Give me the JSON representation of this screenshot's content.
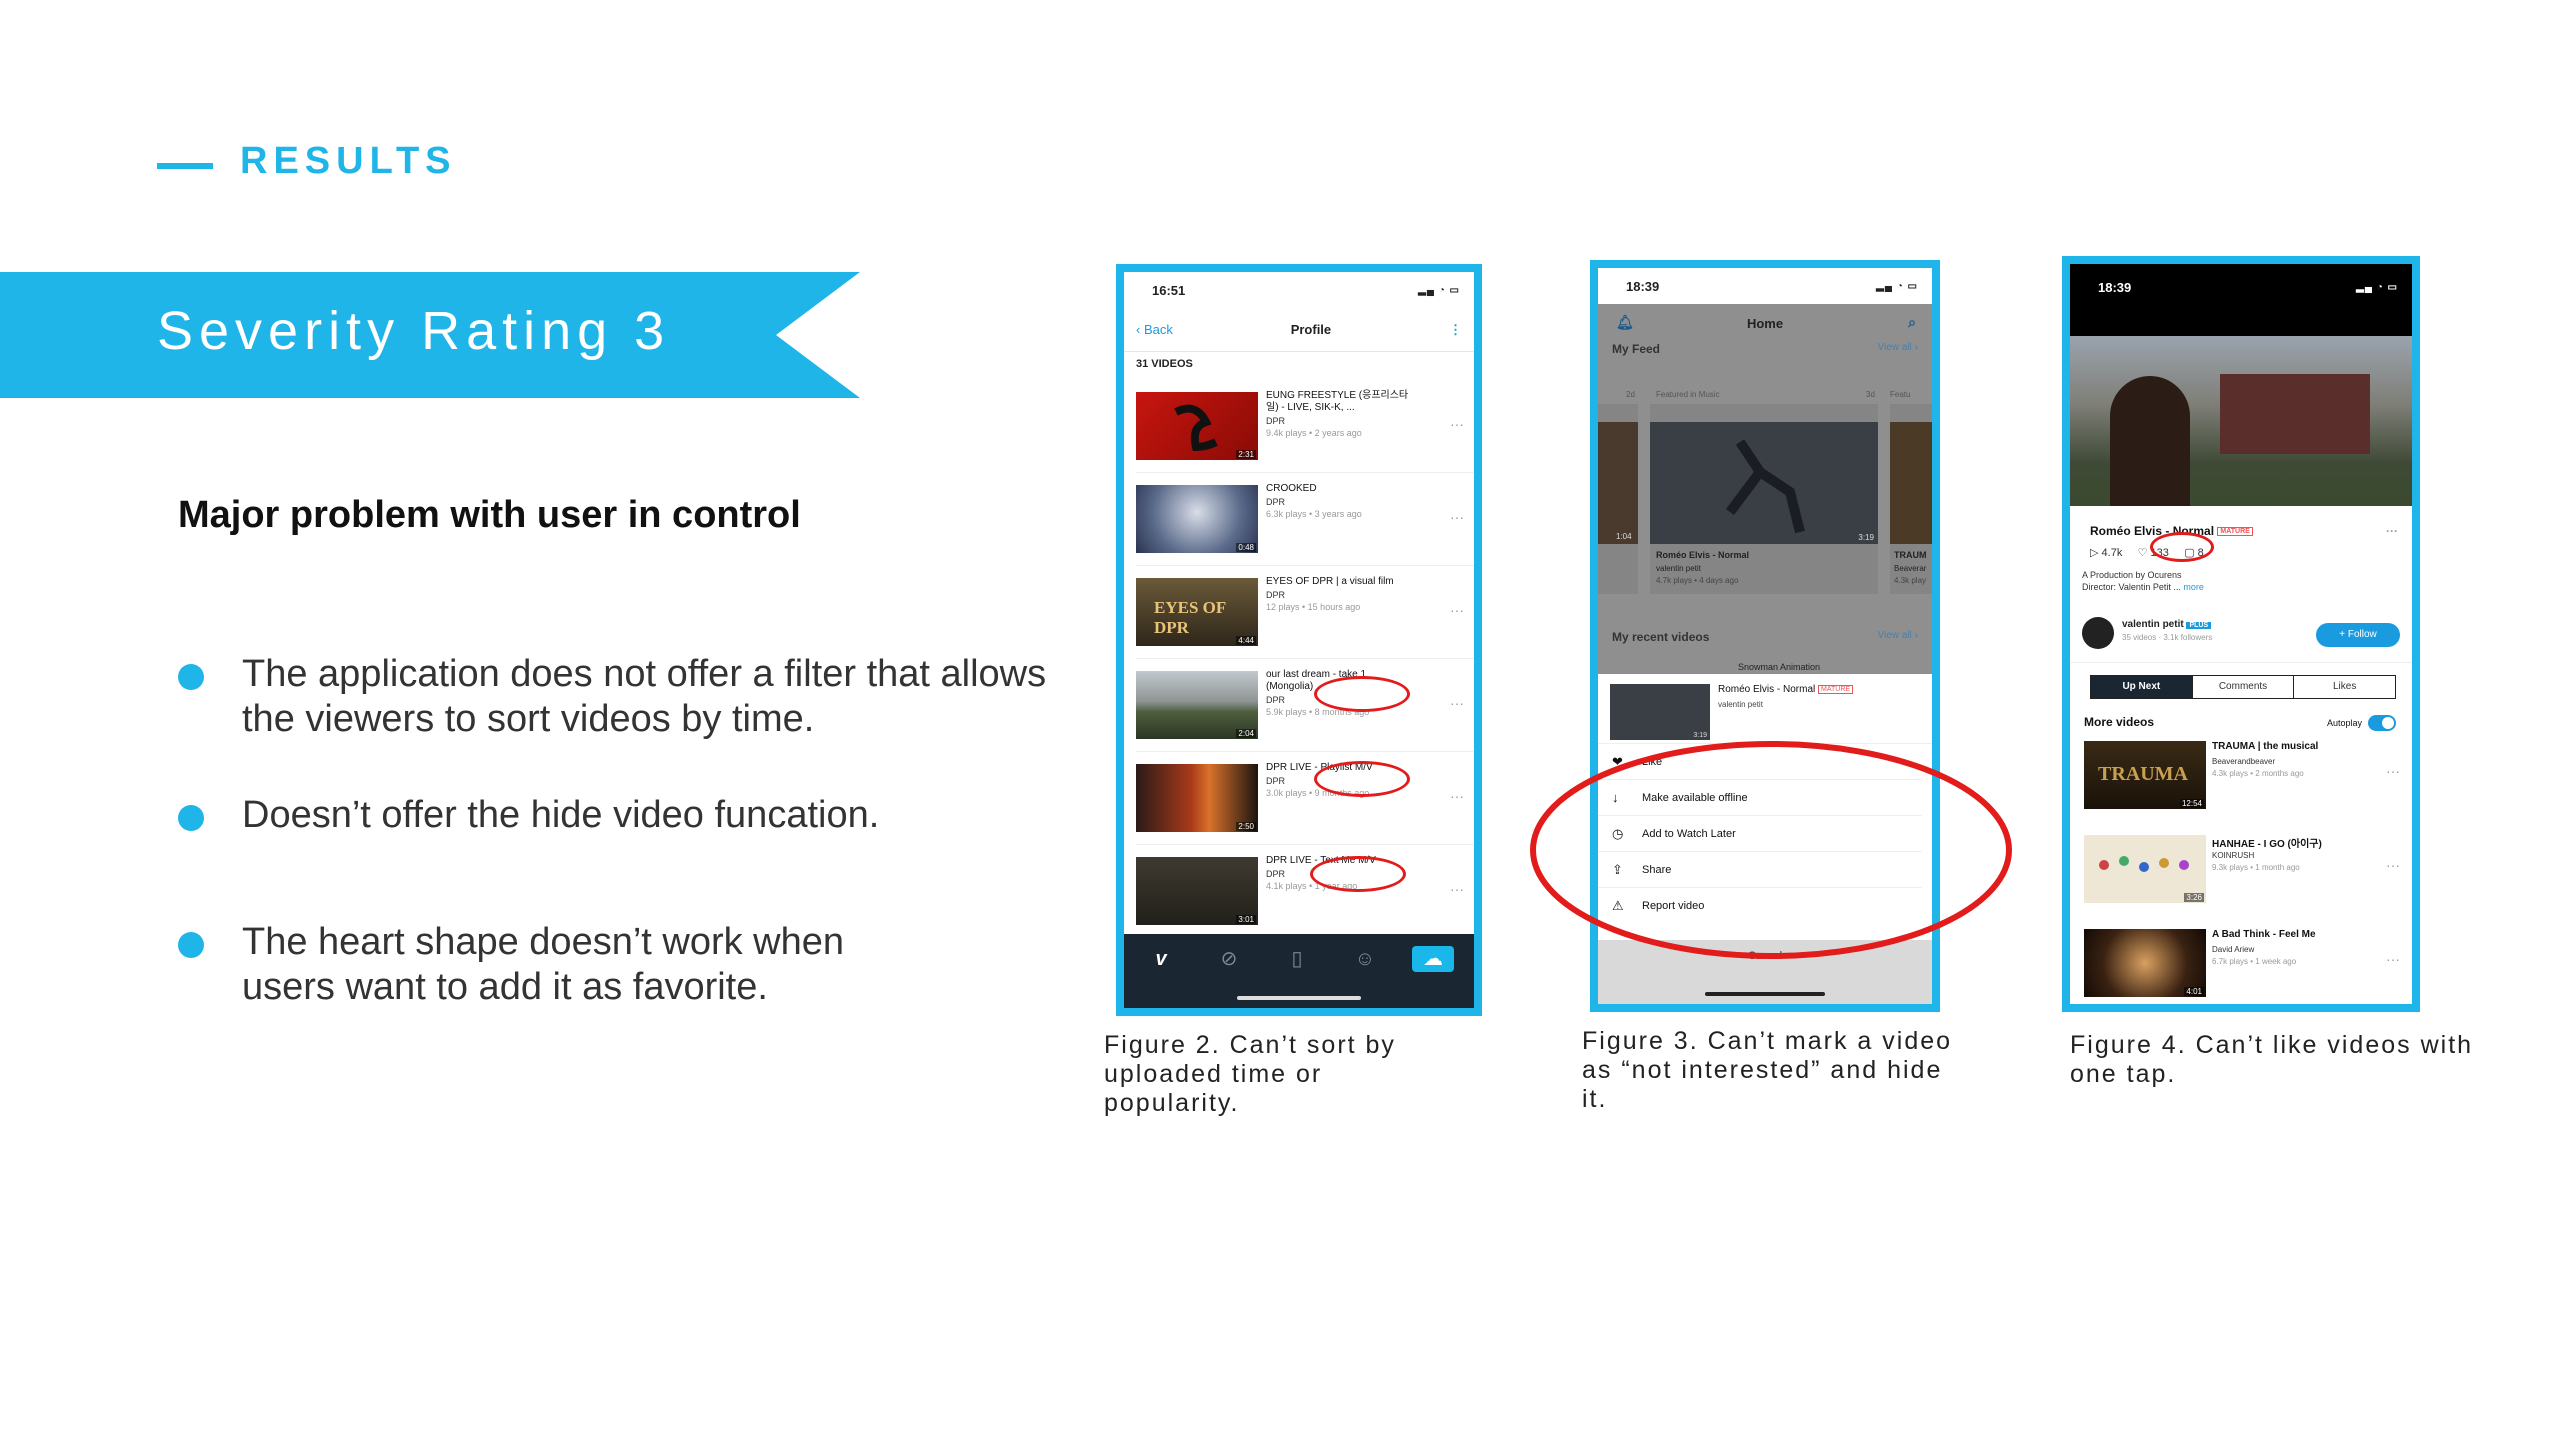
{
  "header": {
    "section": "RESULTS"
  },
  "banner": {
    "title": "Severity Rating 3"
  },
  "subtitle": "Major problem with user in control",
  "bullets": [
    "The application does not offer a filter that allows the viewers to sort videos by time.",
    "Doesn’t offer the hide video funcation.",
    "The heart shape doesn’t work when users want to add it as favorite."
  ],
  "captions": {
    "fig2": "Figure 2. Can’t sort by uploaded time or popularity.",
    "fig3": "Figure 3. Can’t mark a video as “not interested” and hide it.",
    "fig4": "Figure 4. Can’t like videos with one tap."
  },
  "colors": {
    "accent": "#1fb5e8",
    "highlight_ring": "#e21b1b"
  },
  "phone1": {
    "time": "16:51",
    "back": "Back",
    "title": "Profile",
    "count": "31 VIDEOS",
    "videos": [
      {
        "title": "EUNG FREESTYLE (응프리스타일) - LIVE, SIK-K, ...",
        "channel": "DPR",
        "meta": "9.4k plays • 2 years ago",
        "dur": "2:31"
      },
      {
        "title": "CROOKED",
        "channel": "DPR",
        "meta": "6.3k plays • 3 years ago",
        "dur": "0:48"
      },
      {
        "title": "EYES OF DPR | a visual film",
        "channel": "DPR",
        "meta": "12 plays • 15 hours ago",
        "dur": "4:44"
      },
      {
        "title": "our last dream - take 1 (Mongolia)",
        "channel": "DPR",
        "meta": "5.9k plays • 8 months ago",
        "dur": "2:04"
      },
      {
        "title": "DPR LIVE - Playlist M/V",
        "channel": "DPR",
        "meta": "3.0k plays • 9 months ago",
        "dur": "2:50"
      },
      {
        "title": "DPR LIVE - Text Me M/V",
        "channel": "DPR",
        "meta": "4.1k plays • 1 year ago",
        "dur": "3:01"
      }
    ],
    "tabs": [
      "vimeo-icon",
      "compass-icon",
      "bookmark-icon",
      "smiley-icon",
      "upload-icon"
    ]
  },
  "phone2": {
    "time": "18:39",
    "title": "Home",
    "feed_label": "My Feed",
    "view_all": "View all ›",
    "feed_tag_left": "2d",
    "feed_tag": "Featured in Music",
    "feed_tag_right": "3d",
    "feed_tag2": "Featu",
    "card_title": "Roméo Elvis - Normal",
    "card_user": "valentin petit",
    "card_meta": "4.7k plays • 4 days ago",
    "card_dur": "3:19",
    "left_dur": "1:04",
    "card2_title": "TRAUM",
    "card2_user": "Beaverar",
    "card2_meta": "4.3k play",
    "recent_label": "My recent videos",
    "recent_peek": "Snowman Animation",
    "sheet_title": "Roméo Elvis - Normal",
    "sheet_badge": "MATURE",
    "sheet_user": "valentin petit",
    "sheet_dur": "3:19",
    "actions": [
      {
        "icon": "heart-icon",
        "glyph": "❤",
        "label": "Like"
      },
      {
        "icon": "download-icon",
        "glyph": "↓",
        "label": "Make available offline"
      },
      {
        "icon": "clock-icon",
        "glyph": "◷",
        "label": "Add to Watch Later"
      },
      {
        "icon": "share-icon",
        "glyph": "⇪",
        "label": "Share"
      },
      {
        "icon": "warning-icon",
        "glyph": "⚠",
        "label": "Report video"
      }
    ],
    "cancel": "Cancel"
  },
  "phone3": {
    "time": "18:39",
    "title": "Roméo Elvis - Normal",
    "badge": "MATURE",
    "plays": "4.7k",
    "likes": "133",
    "comments": "8",
    "desc1": "A Production by Ocurens",
    "desc2": "Director: Valentin Petit ...",
    "more": "more",
    "user": "valentin petit",
    "plus": "PLUS",
    "user_meta": "35 videos · 3.1k followers",
    "follow": "+ Follow",
    "tabs": [
      "Up Next",
      "Comments",
      "Likes"
    ],
    "more_videos": "More videos",
    "autoplay": "Autoplay",
    "videos": [
      {
        "title": "TRAUMA | the musical",
        "channel": "Beaverandbeaver",
        "meta": "4.3k plays • 2 months ago",
        "dur": "12:54",
        "thumb_text": "TRAUMA"
      },
      {
        "title": "HANHAE - I GO (아이구)",
        "channel": "KOINRUSH",
        "meta": "9.3k plays • 1 month ago",
        "dur": "3:26",
        "thumb_text": ""
      },
      {
        "title": "A Bad Think - Feel Me",
        "channel": "David Ariew",
        "meta": "6.7k plays • 1 week ago",
        "dur": "4:01",
        "thumb_text": ""
      }
    ]
  }
}
